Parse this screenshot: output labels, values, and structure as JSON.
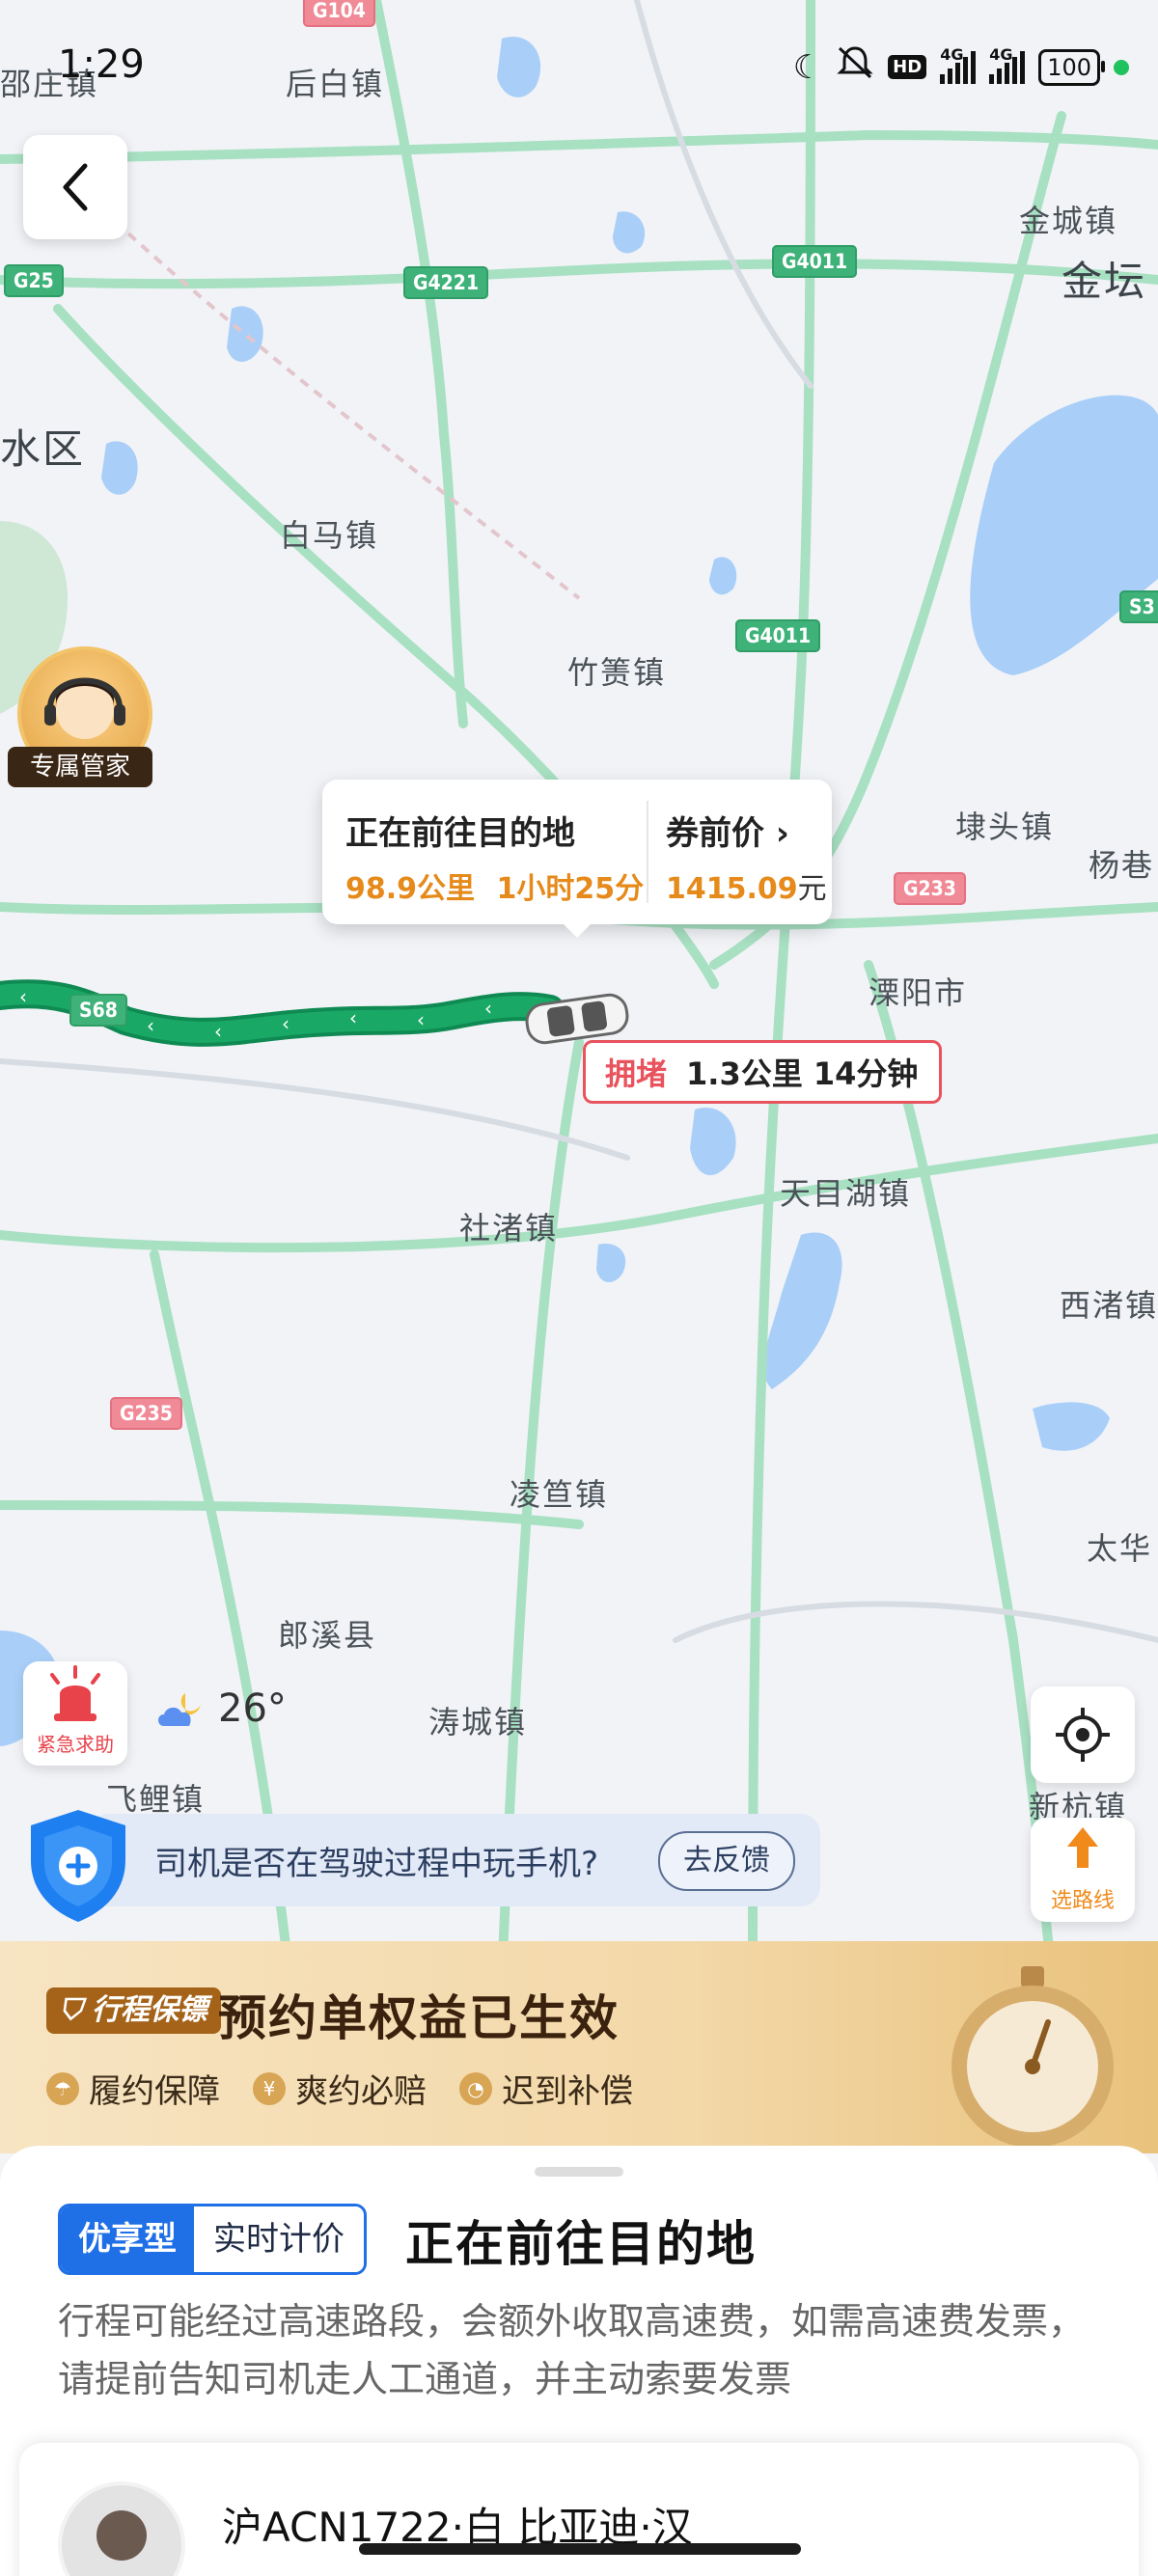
{
  "status_bar": {
    "time": "1:29",
    "network_1": "4G",
    "network_2": "4G",
    "hd_label": "HD",
    "battery": "100"
  },
  "map": {
    "places": [
      "邵庄镇",
      "后白镇",
      "金城镇",
      "金坛",
      "水区",
      "白马镇",
      "竹箦镇",
      "埭头镇",
      "杨巷",
      "溧阳市",
      "天目湖镇",
      "社渚镇",
      "西渚镇",
      "凌笪镇",
      "太华",
      "郎溪县",
      "涛城镇",
      "飞鲤镇",
      "新杭镇"
    ],
    "road_shields": [
      "G104",
      "G25",
      "G4221",
      "G4011",
      "G4011",
      "S3",
      "G233",
      "S68",
      "G235"
    ]
  },
  "butler": {
    "label": "专属管家"
  },
  "trip_card": {
    "title": "正在前往目的地",
    "distance": "98.9公里",
    "duration": "1小时25分",
    "price_label": "券前价",
    "price": "1415.09",
    "price_unit": "元"
  },
  "congestion": {
    "label": "拥堵",
    "detail": "1.3公里 14分钟"
  },
  "emergency": {
    "label": "紧急求助"
  },
  "weather": {
    "temperature": "26°"
  },
  "route_button": {
    "label": "选路线"
  },
  "feedback": {
    "question": "司机是否在驾驶过程中玩手机?",
    "button": "去反馈"
  },
  "benefit": {
    "badge": "行程保镖",
    "title": "预约单权益已生效",
    "items": [
      "履约保障",
      "爽约必赔",
      "迟到补偿"
    ]
  },
  "sheet": {
    "service_type": "优享型",
    "pricing_mode": "实时计价",
    "title": "正在前往目的地",
    "notice": "行程可能经过高速路段，会额外收取高速费，如需高速费发票，请提前告知司机走人工通道，并主动索要发票",
    "driver_info": "沪ACN1722·白 比亚迪·汉"
  },
  "colors": {
    "route_green": "#19a866",
    "accent_orange": "#e58a1b",
    "congestion_red": "#e8535d",
    "brand_blue": "#1f6fe6"
  }
}
